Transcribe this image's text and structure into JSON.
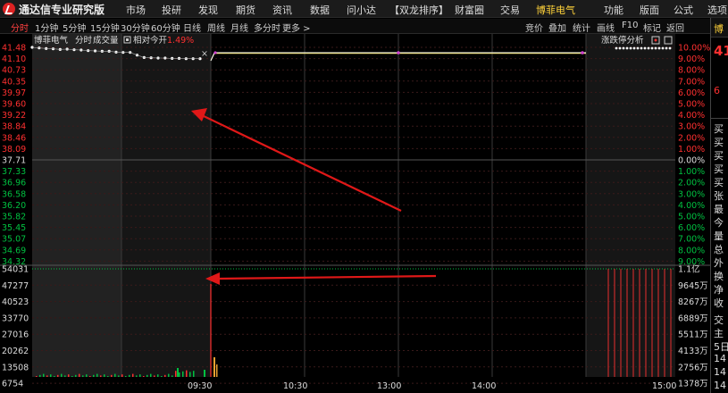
{
  "titlebar": {
    "app_title": "通达信专业研究版",
    "menu": [
      "市场",
      "投研",
      "发现",
      "期货",
      "资讯",
      "数据",
      "问小达",
      "【双龙排序】",
      "财富圈",
      "交易",
      "博菲电气"
    ],
    "right_menu": [
      "功能",
      "版面",
      "公式",
      "选项"
    ]
  },
  "periodbar": {
    "periods": [
      "分时",
      "1分钟",
      "5分钟",
      "15分钟",
      "30分钟",
      "60分钟",
      "日线",
      "周线",
      "月线",
      "多分时",
      "更多 >"
    ],
    "tools": [
      "竞价",
      "叠加",
      "统计",
      "画线",
      "F10",
      "标记",
      "返回"
    ]
  },
  "chart_header": {
    "stock_name": "博菲电气",
    "mode": "分时",
    "volume_label": "成交量",
    "relative_label": "相对今开",
    "relative_value": "1.49%",
    "limit_analysis": "涨跌停分析",
    "close_symbol": "×"
  },
  "chart_data": {
    "type": "line",
    "left_price_ticks": [
      "41.48",
      "41.10",
      "40.73",
      "40.35",
      "39.97",
      "39.60",
      "39.22",
      "38.84",
      "38.46",
      "38.09",
      "37.71",
      "37.33",
      "36.96",
      "36.58",
      "36.20",
      "35.82",
      "35.45",
      "35.07",
      "34.69",
      "34.32"
    ],
    "right_pct_ticks": [
      "10.00%",
      "9.00%",
      "8.00%",
      "7.00%",
      "6.00%",
      "5.00%",
      "4.00%",
      "3.00%",
      "2.00%",
      "1.00%",
      "0.00%",
      "1.00%",
      "2.00%",
      "3.00%",
      "4.00%",
      "5.00%",
      "6.00%",
      "7.00%",
      "8.00%",
      "9.00%"
    ],
    "prev_close": 37.71,
    "limit_up": 41.48,
    "vol_left_ticks": [
      "54031",
      "47277",
      "40523",
      "33770",
      "27016",
      "20262",
      "13508",
      "6754"
    ],
    "vol_right_ticks": [
      "1.1亿",
      "9645万",
      "8267万",
      "6889万",
      "5511万",
      "4133万",
      "2756万",
      "1378万"
    ],
    "time_ticks": [
      "09:30",
      "10:30",
      "13:00",
      "14:00",
      "15:00"
    ],
    "auction_price": [
      41.48,
      41.46,
      41.44,
      41.43,
      41.41,
      41.42,
      41.4,
      41.39,
      41.37,
      41.36,
      41.35,
      41.35,
      41.32,
      41.31,
      41.31,
      41.22,
      41.14,
      41.13,
      41.12,
      41.12,
      41.11,
      41.11,
      41.1,
      41.1,
      41.1
    ],
    "price_line": 41.3,
    "avg_line": 41.28,
    "limit_vol_count": 11
  },
  "side_panel": {
    "top_name": "博",
    "price": "41",
    "vol_small": "6",
    "labels": [
      "买",
      "买",
      "买",
      "买",
      "买",
      "张",
      "最",
      "今",
      "量",
      "总",
      "外",
      "换",
      "净",
      "收",
      "交",
      "主",
      "5日",
      "14",
      "14",
      "14"
    ]
  },
  "colors": {
    "up": "#ff3030",
    "down": "#00c040",
    "price": "#ffffff",
    "avg": "#e6d23c",
    "arrow": "#e01818",
    "grid": "#3a1a1a"
  }
}
